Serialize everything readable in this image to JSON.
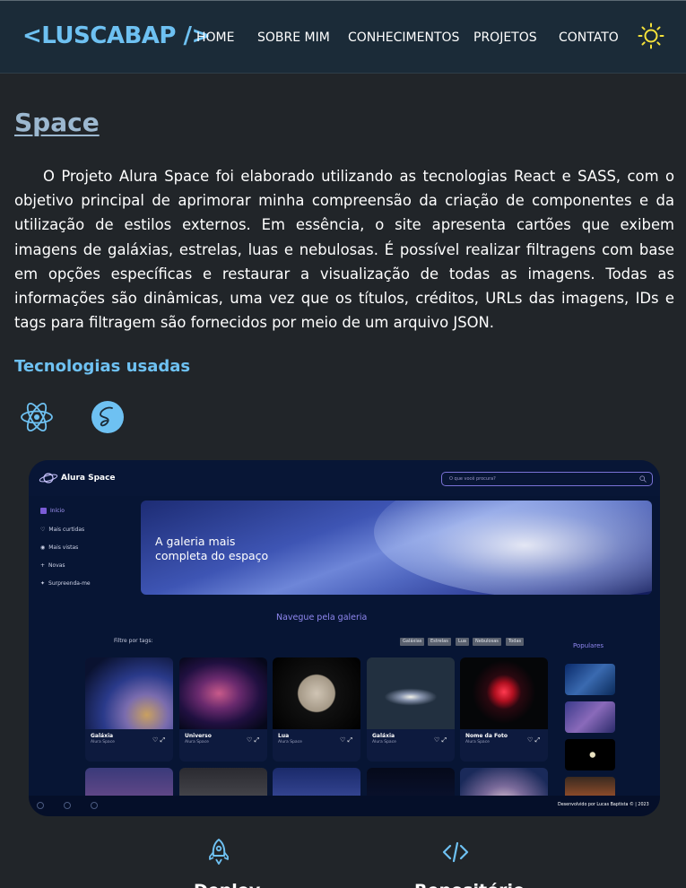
{
  "header": {
    "logo": "<LUSCABAP />",
    "nav": [
      "HOME",
      "SOBRE MIM",
      "CONHECIMENTOS",
      "PROJETOS",
      "CONTATO"
    ],
    "theme_icon": "sun-icon",
    "accent": "#6ec1f2"
  },
  "project": {
    "title": "Space",
    "description": "O Projeto Alura Space foi elaborado utilizando as tecnologias React e SASS, com o objetivo principal de aprimorar minha compreensão da criação de componentes e da utilização de estilos externos. Em essência, o site apresenta cartões que exibem imagens de galáxias, estrelas, luas e nebulosas. É possível realizar filtragens com base em opções específicas e restaurar a visualização de todas as imagens. Todas as informações são dinâmicas, uma vez que os títulos, créditos, URLs das imagens, IDs e tags para filtragem são fornecidos por meio de um arquivo JSON.",
    "tech_heading": "Tecnologias usadas",
    "tech_icons": [
      "react-icon",
      "sass-icon"
    ]
  },
  "preview": {
    "brand": "Alura Space",
    "search_placeholder": "O que você procura?",
    "menu": [
      "Início",
      "Mais curtidas",
      "Mais vistas",
      "Novas",
      "Surpreenda-me"
    ],
    "hero_line1": "A galeria mais",
    "hero_line2": "completa do espaço",
    "gallery_title": "Navegue pela galeria",
    "filter_label": "Filtre por tags:",
    "tags": [
      "Galáxias",
      "Estrelas",
      "Lua",
      "Nebulosas",
      "Todas"
    ],
    "popular_title": "Populares",
    "cards": [
      {
        "title": "Galáxia",
        "credit": "Alura Space"
      },
      {
        "title": "Universo",
        "credit": "Alura Space"
      },
      {
        "title": "Lua",
        "credit": "Alura Space"
      },
      {
        "title": "Galáxia",
        "credit": "Alura Space"
      },
      {
        "title": "Nome da Foto",
        "credit": "Alura Space"
      }
    ],
    "footer": "Desenvolvido por Lucas Baptista © | 2023"
  },
  "links": {
    "deploy": "Deploy",
    "repo": "Repositório"
  }
}
